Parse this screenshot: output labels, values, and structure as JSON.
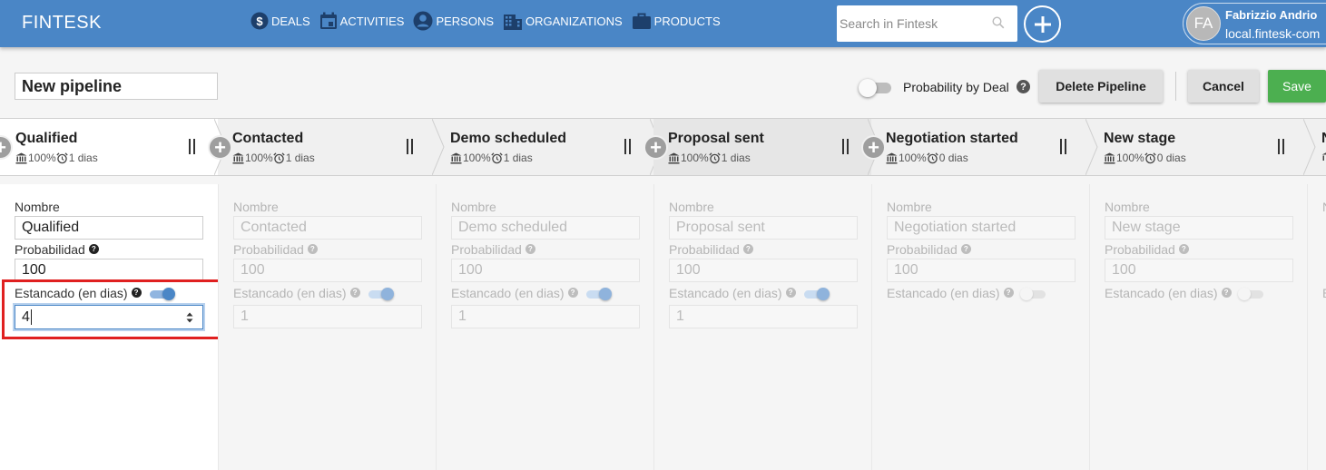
{
  "app": {
    "brand": "FINTESK"
  },
  "nav": [
    {
      "label": "DEALS",
      "icon": "dollar-circle-icon"
    },
    {
      "label": "ACTIVITIES",
      "icon": "calendar-icon"
    },
    {
      "label": "PERSONS",
      "icon": "person-circle-icon"
    },
    {
      "label": "ORGANIZATIONS",
      "icon": "building-icon"
    },
    {
      "label": "PRODUCTS",
      "icon": "briefcase-icon"
    }
  ],
  "search": {
    "placeholder": "Search in Fintesk"
  },
  "user": {
    "initials": "FA",
    "name": "Fabrizzio Andrio",
    "domain": "local.fintesk-com"
  },
  "toolbar": {
    "pipeline_name": "New pipeline",
    "probability_label": "Probability by Deal",
    "help": "?",
    "delete_label": "Delete Pipeline",
    "cancel_label": "Cancel",
    "save_label": "Save"
  },
  "stages": [
    {
      "title": "Qualified",
      "probability": "100%",
      "rotting": "1 dias"
    },
    {
      "title": "Contacted",
      "probability": "100%",
      "rotting": "1 dias"
    },
    {
      "title": "Demo scheduled",
      "probability": "100%",
      "rotting": "1 dias"
    },
    {
      "title": "Proposal sent",
      "probability": "100%",
      "rotting": "1 dias"
    },
    {
      "title": "Negotiation started",
      "probability": "100%",
      "rotting": "0 dias"
    },
    {
      "title": "New stage",
      "probability": "100%",
      "rotting": "0 dias"
    },
    {
      "title": "N"
    }
  ],
  "form_labels": {
    "name": "Nombre",
    "probability": "Probabilidad",
    "stagnant": "Estancado (en dias)",
    "partial": "N",
    "partial_e": "E"
  },
  "columns": [
    {
      "name": "Qualified",
      "probability": "100",
      "stagnant_enabled": true,
      "stagnant_days": "4"
    },
    {
      "name": "Contacted",
      "probability": "100",
      "stagnant_enabled": true,
      "stagnant_days": "1"
    },
    {
      "name": "Demo scheduled",
      "probability": "100",
      "stagnant_enabled": true,
      "stagnant_days": "1"
    },
    {
      "name": "Proposal sent",
      "probability": "100",
      "stagnant_enabled": true,
      "stagnant_days": "1"
    },
    {
      "name": "Negotiation started",
      "probability": "100",
      "stagnant_enabled": false
    },
    {
      "name": "New stage",
      "probability": "100",
      "stagnant_enabled": false
    }
  ],
  "colors": {
    "header": "#4a86c6",
    "save": "#4caf50",
    "highlight": "#e02020"
  }
}
